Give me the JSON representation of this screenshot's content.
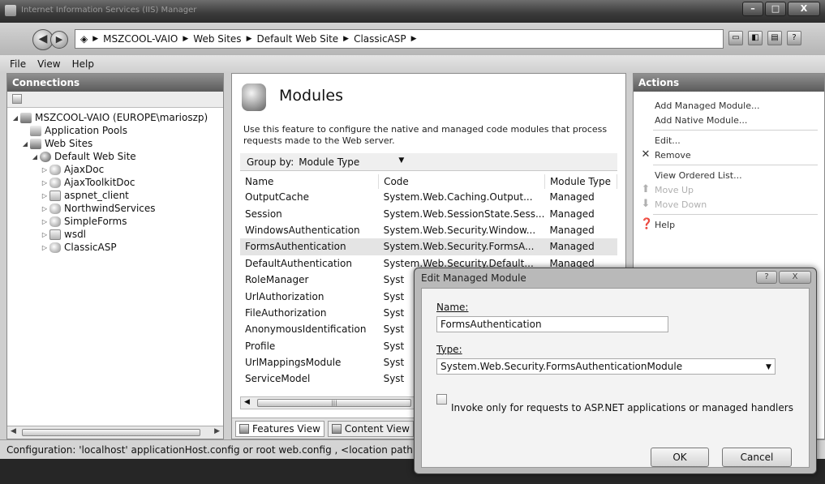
{
  "window": {
    "title": "Internet Information Services (IIS) Manager"
  },
  "address": {
    "crumbs": [
      "MSZCOOL-VAIO",
      "Web Sites",
      "Default Web Site",
      "ClassicASP"
    ]
  },
  "menu": {
    "items": [
      "File",
      "View",
      "Help"
    ]
  },
  "connections": {
    "title": "Connections",
    "tree": [
      {
        "label": "MSZCOOL-VAIO (EUROPE\\marioszp)",
        "level": 0,
        "expander": "◢",
        "icon": "server-icon"
      },
      {
        "label": "Application Pools",
        "level": 1,
        "expander": "",
        "icon": "app-pool-icon"
      },
      {
        "label": "Web Sites",
        "level": 1,
        "expander": "◢",
        "icon": "web-sites-icon"
      },
      {
        "label": "Default Web Site",
        "level": 2,
        "expander": "◢",
        "icon": "globe-icon"
      },
      {
        "label": "AjaxDoc",
        "level": 3,
        "expander": "▷",
        "icon": "application-icon"
      },
      {
        "label": "AjaxToolkitDoc",
        "level": 3,
        "expander": "▷",
        "icon": "application-icon"
      },
      {
        "label": "aspnet_client",
        "level": 3,
        "expander": "▷",
        "icon": "folder-icon"
      },
      {
        "label": "NorthwindServices",
        "level": 3,
        "expander": "▷",
        "icon": "application-icon"
      },
      {
        "label": "SimpleForms",
        "level": 3,
        "expander": "▷",
        "icon": "application-icon"
      },
      {
        "label": "wsdl",
        "level": 3,
        "expander": "▷",
        "icon": "folder-icon"
      },
      {
        "label": "ClassicASP",
        "level": 3,
        "expander": "▷",
        "icon": "application-icon"
      }
    ]
  },
  "modules": {
    "title": "Modules",
    "description": "Use this feature to configure the native and managed code modules that process requests made to the Web server.",
    "group_by_label": "Group by:",
    "group_by_value": "Module Type",
    "columns": [
      "Name",
      "Code",
      "Module Type"
    ],
    "rows": [
      {
        "name": "OutputCache",
        "code": "System.Web.Caching.Output...",
        "type": "Managed"
      },
      {
        "name": "Session",
        "code": "System.Web.SessionState.Sess...",
        "type": "Managed"
      },
      {
        "name": "WindowsAuthentication",
        "code": "System.Web.Security.Window...",
        "type": "Managed"
      },
      {
        "name": "FormsAuthentication",
        "code": "System.Web.Security.FormsA...",
        "type": "Managed"
      },
      {
        "name": "DefaultAuthentication",
        "code": "System.Web.Security.Default...",
        "type": "Managed"
      },
      {
        "name": "RoleManager",
        "code": "Syst",
        "type": ""
      },
      {
        "name": "UrlAuthorization",
        "code": "Syst",
        "type": ""
      },
      {
        "name": "FileAuthorization",
        "code": "Syst",
        "type": ""
      },
      {
        "name": "AnonymousIdentification",
        "code": "Syst",
        "type": ""
      },
      {
        "name": "Profile",
        "code": "Syst",
        "type": ""
      },
      {
        "name": "UrlMappingsModule",
        "code": "Syst",
        "type": ""
      },
      {
        "name": "ServiceModel",
        "code": "Syst",
        "type": ""
      }
    ],
    "selected_row": 3,
    "tabs": [
      "Features View",
      "Content View"
    ]
  },
  "actions": {
    "title": "Actions",
    "items": [
      {
        "label": "Add Managed Module...",
        "enabled": true,
        "icon": ""
      },
      {
        "label": "Add Native Module...",
        "enabled": true,
        "icon": ""
      },
      {
        "sep": true
      },
      {
        "label": "Edit...",
        "enabled": true,
        "icon": ""
      },
      {
        "label": "Remove",
        "enabled": true,
        "icon": "remove-icon"
      },
      {
        "sep": true
      },
      {
        "label": "View Ordered List...",
        "enabled": true,
        "icon": ""
      },
      {
        "label": "Move Up",
        "enabled": false,
        "icon": "move-up-icon"
      },
      {
        "label": "Move Down",
        "enabled": false,
        "icon": "move-down-icon"
      },
      {
        "sep": true
      },
      {
        "label": "Help",
        "enabled": true,
        "icon": "help-icon"
      }
    ]
  },
  "status": {
    "text": "Configuration: 'localhost' applicationHost.config or root web.config , <location path=\"Def"
  },
  "dialog": {
    "title": "Edit Managed Module",
    "name_label": "Name:",
    "name_value": "FormsAuthentication",
    "type_label": "Type:",
    "type_value": "System.Web.Security.FormsAuthenticationModule",
    "checkbox_label": "Invoke only for requests to ASP.NET applications or managed handlers",
    "checkbox_checked": false,
    "ok_label": "OK",
    "cancel_label": "Cancel",
    "help_glyph": "?",
    "close_glyph": "X"
  }
}
